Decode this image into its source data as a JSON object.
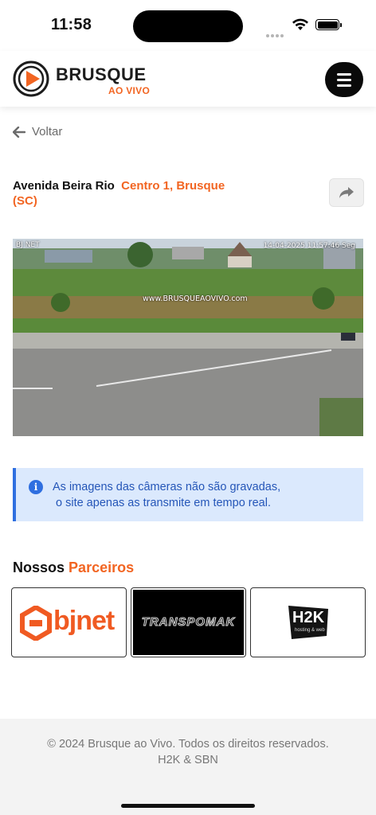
{
  "status_bar": {
    "time": "11:58"
  },
  "header": {
    "brand_name": "BRUSQUE",
    "brand_sub": "AO VIVO",
    "menu_icon": "hamburger-icon",
    "accent_color": "#f26522"
  },
  "nav": {
    "back_label": "Voltar",
    "back_icon": "arrow-left-icon"
  },
  "camera": {
    "street": "Avenida Beira Rio",
    "location": "Centro 1, Brusque (SC)",
    "share_icon": "share-icon",
    "osd_left": "BJ NET",
    "osd_right": "14-04-2025 11:57:46 Seg",
    "watermark": "www.BRUSQUEAOVIVO.com"
  },
  "alert": {
    "icon": "info-icon",
    "line1": "As imagens das câmeras não são gravadas,",
    "line2": "o site apenas as transmite em tempo real.",
    "color": "#2f6fe0"
  },
  "partners": {
    "title_prefix": "Nossos",
    "title_accent": "Parceiros",
    "items": [
      {
        "name": "bjnet"
      },
      {
        "name": "TRANSPOMAK"
      },
      {
        "name": "H2K",
        "tagline": "hosting & web"
      }
    ]
  },
  "footer": {
    "line1": "© 2024 Brusque ao Vivo. Todos os direitos reservados.",
    "line2": "H2K & SBN"
  }
}
